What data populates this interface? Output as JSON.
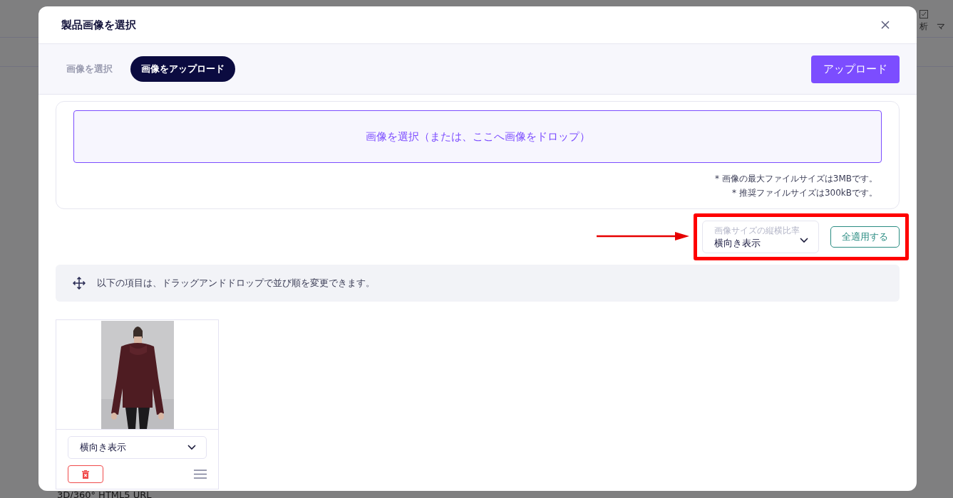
{
  "background": {
    "header_items": [
      {
        "label": "析"
      },
      {
        "label": "マ"
      }
    ],
    "footer_label": "3D/360° HTML5 URL"
  },
  "modal": {
    "title": "製品画像を選択",
    "tabs": [
      {
        "label": "画像を選択",
        "selected": false
      },
      {
        "label": "画像をアップロード",
        "selected": true
      }
    ],
    "upload_button": "アップロード",
    "dropzone": "画像を選択（または、ここへ画像をドロップ）",
    "notes": [
      "* 画像の最大ファイルサイズは3MBです。",
      "* 推奨ファイルサイズは300kBです。"
    ],
    "aspect": {
      "label": "画像サイズの縦横比率",
      "value": "横向き表示"
    },
    "apply_all": "全適用する",
    "hint": "以下の項目は、ドラッグアンドドロップで並び順を変更できます。",
    "images": [
      {
        "kind": "picture",
        "aspect": "横向き表示"
      }
    ]
  },
  "annotation": {
    "highlight_box": true,
    "arrow": true
  }
}
